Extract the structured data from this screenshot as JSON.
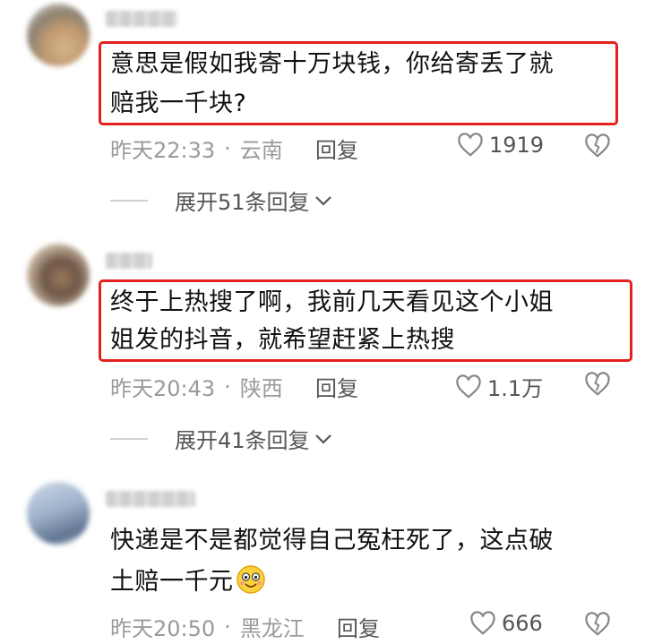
{
  "comments": [
    {
      "text_lines": [
        "意思是假如我寄十万块钱，你给寄丢了就",
        "赔我一千块?"
      ],
      "time": "昨天22:33",
      "location": "云南",
      "reply_label": "回复",
      "likes": "1919",
      "expand_label": "展开51条回复"
    },
    {
      "text_lines": [
        "终于上热搜了啊，我前几天看见这个小姐",
        "姐发的抖音，就希望赶紧上热搜"
      ],
      "time": "昨天20:43",
      "location": "陕西",
      "reply_label": "回复",
      "likes": "1.1万",
      "expand_label": "展开41条回复"
    },
    {
      "text_lines": [
        "快递是不是都觉得自己冤枉死了，这点破",
        "土赔一千元"
      ],
      "time": "昨天20:50",
      "location": "黑龙江",
      "reply_label": "回复",
      "likes": "666"
    }
  ],
  "separator": "·",
  "colors": {
    "highlight": "#e4211f",
    "meta": "#9a9a9a"
  }
}
